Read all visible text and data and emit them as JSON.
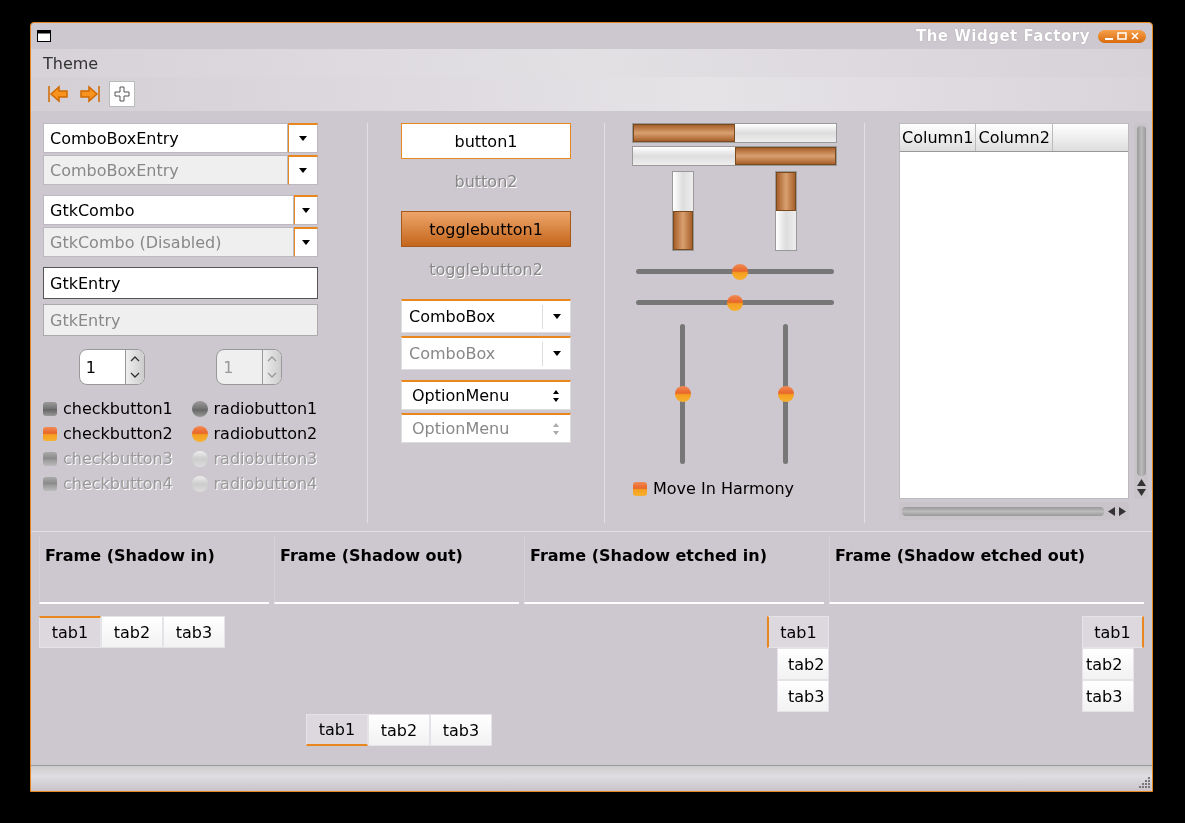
{
  "window": {
    "title": "The Widget Factory"
  },
  "menu": [
    {
      "label": "Theme"
    }
  ],
  "combo_entries": [
    {
      "value": "ComboBoxEntry",
      "disabled": false
    },
    {
      "value": "ComboBoxEntry",
      "disabled": true
    }
  ],
  "gtk_combos": [
    {
      "value": "GtkCombo",
      "disabled": false
    },
    {
      "value": "GtkCombo (Disabled)",
      "disabled": true
    }
  ],
  "entries": [
    {
      "value": "GtkEntry",
      "disabled": false
    },
    {
      "value": "GtkEntry",
      "disabled": true
    }
  ],
  "spinbuttons": [
    {
      "value": "1",
      "disabled": false
    },
    {
      "value": "1",
      "disabled": true
    }
  ],
  "checks": [
    {
      "label": "checkbutton1",
      "checked": false,
      "disabled": false
    },
    {
      "label": "checkbutton2",
      "checked": true,
      "disabled": false
    },
    {
      "label": "checkbutton3",
      "checked": false,
      "disabled": true
    },
    {
      "label": "checkbutton4",
      "checked": false,
      "disabled": true
    }
  ],
  "radios": [
    {
      "label": "radiobutton1",
      "selected": false,
      "disabled": false
    },
    {
      "label": "radiobutton2",
      "selected": true,
      "disabled": false
    },
    {
      "label": "radiobutton3",
      "selected": false,
      "disabled": true
    },
    {
      "label": "radiobutton4",
      "selected": false,
      "disabled": true
    }
  ],
  "buttons": [
    {
      "label": "button1",
      "disabled": false
    },
    {
      "label": "button2",
      "disabled": true
    }
  ],
  "toggles": [
    {
      "label": "togglebutton1",
      "on": true,
      "disabled": false
    },
    {
      "label": "togglebutton2",
      "on": false,
      "disabled": true
    }
  ],
  "comboboxes": [
    {
      "value": "ComboBox",
      "disabled": false
    },
    {
      "value": "ComboBox",
      "disabled": true
    }
  ],
  "option_menus": [
    {
      "value": "OptionMenu",
      "disabled": false
    },
    {
      "value": "OptionMenu",
      "disabled": true
    }
  ],
  "progress_bars": [
    {
      "inverted": false,
      "level": 0.5
    },
    {
      "inverted": true,
      "level": 0.5
    }
  ],
  "vertical_progress_bars": [
    {
      "inverted": false,
      "level": 0.5
    },
    {
      "inverted": true,
      "level": 0.5
    }
  ],
  "hscales": [
    {
      "level": 0.53
    },
    {
      "level": 0.5
    }
  ],
  "vscales": [
    {
      "level": 0.5
    },
    {
      "level": 0.5
    }
  ],
  "harmony": {
    "label": "Move In Harmony",
    "checked": true
  },
  "tree": {
    "columns": [
      "Column1",
      "Column2"
    ]
  },
  "frames": [
    {
      "title": "Frame (Shadow in)"
    },
    {
      "title": "Frame (Shadow out)"
    },
    {
      "title": "Frame (Shadow etched in)"
    },
    {
      "title": "Frame (Shadow etched out)"
    }
  ],
  "notebooks": [
    {
      "kind": "top",
      "tabs": [
        {
          "label": "tab1",
          "selected": true
        },
        {
          "label": "tab2",
          "selected": false
        },
        {
          "label": "tab3",
          "selected": false
        }
      ]
    },
    {
      "kind": "bottom",
      "tabs": [
        {
          "label": "tab1",
          "selected": true
        },
        {
          "label": "tab2",
          "selected": false
        },
        {
          "label": "tab3",
          "selected": false
        }
      ]
    },
    {
      "kind": "left",
      "tabs": [
        {
          "label": "tab1",
          "selected": true
        },
        {
          "label": "tab2",
          "selected": false
        },
        {
          "label": "tab3",
          "selected": false
        }
      ]
    },
    {
      "kind": "right",
      "tabs": [
        {
          "label": "tab1",
          "selected": true
        },
        {
          "label": "tab2",
          "selected": false
        },
        {
          "label": "tab3",
          "selected": false
        }
      ]
    }
  ]
}
